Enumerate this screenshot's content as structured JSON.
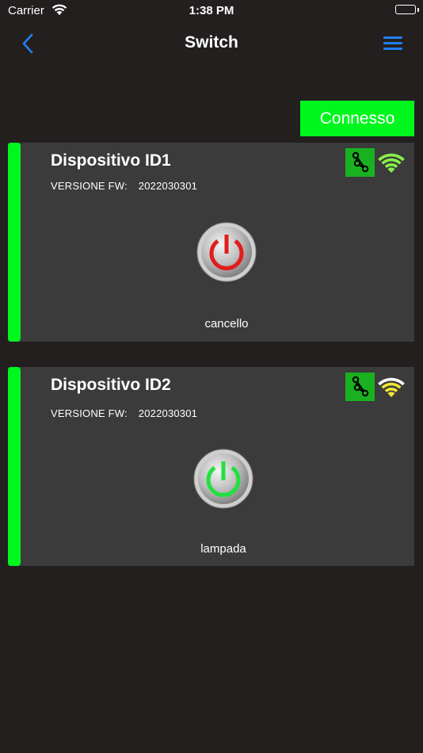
{
  "status_bar": {
    "carrier": "Carrier",
    "time": "1:38 PM"
  },
  "nav": {
    "title": "Switch",
    "back_icon": "chevron-left-icon",
    "menu_icon": "hamburger-menu-icon"
  },
  "connection": {
    "label": "Connesso",
    "color": "#00f71e"
  },
  "devices": [
    {
      "name": "Dispositivo ID1",
      "fw_label": "VERSIONE FW:",
      "fw_version": "2022030301",
      "label": "cancello",
      "power_state": "off",
      "power_color": "#e31c1c",
      "signal_color": "#86f046",
      "mesh_icon": "mesh-network-icon"
    },
    {
      "name": "Dispositivo ID2",
      "fw_label": "VERSIONE FW:",
      "fw_version": "2022030301",
      "label": "lampada",
      "power_state": "on",
      "power_color": "#22e040",
      "signal_color": "#f3e636",
      "mesh_icon": "mesh-network-icon"
    }
  ],
  "colors": {
    "background": "#231f1f",
    "card": "#3b3b3b",
    "accent_blue": "#1f7ff0",
    "mesh_badge": "#19b11f"
  }
}
